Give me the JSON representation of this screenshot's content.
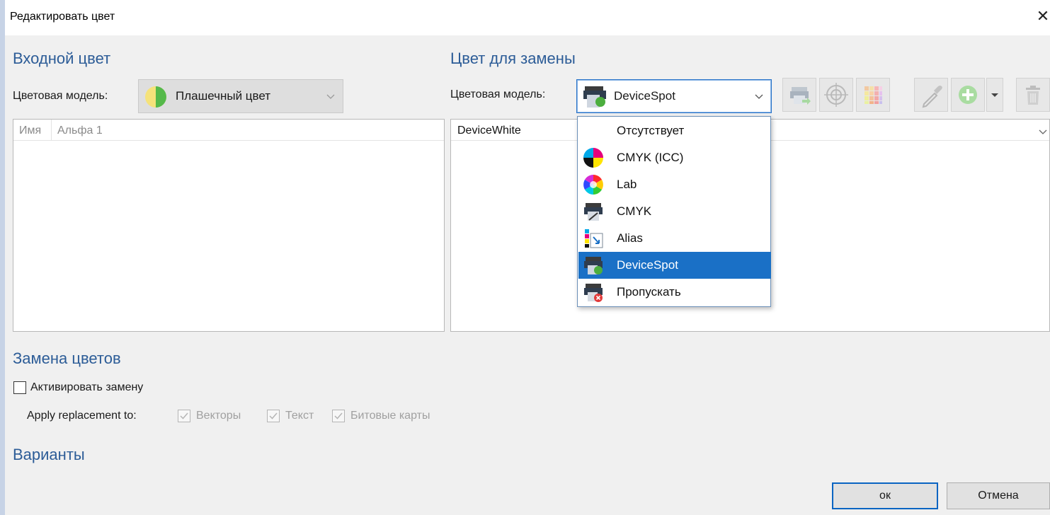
{
  "window": {
    "title": "Редактировать цвет",
    "close_glyph": "✕"
  },
  "input_color": {
    "heading": "Входной цвет",
    "model_label": "Цветовая модель:",
    "model_value": "Плашечный цвет",
    "model_icon": "spot-color-icon",
    "table": {
      "col_name": "Имя",
      "col_value": "Альфа 1"
    }
  },
  "replace_color": {
    "heading": "Цвет для замены",
    "model_label": "Цветовая модель:",
    "model_value": "DeviceSpot",
    "model_icon": "device-spot-icon",
    "value_selected": "DeviceWhite",
    "toolbar_icons": [
      "printer-arrow-icon",
      "target-icon",
      "color-grid-icon",
      "eyedropper-icon",
      "add-icon",
      "dropdown-arrow-icon",
      "trash-icon"
    ]
  },
  "dropdown": {
    "items": [
      {
        "label": "Отсутствует",
        "icon": "none"
      },
      {
        "label": "CMYK (ICC)",
        "icon": "cmyk-icc-icon"
      },
      {
        "label": "Lab",
        "icon": "lab-icon"
      },
      {
        "label": "CMYK",
        "icon": "cmyk-printer-icon"
      },
      {
        "label": "Alias",
        "icon": "alias-icon"
      },
      {
        "label": "DeviceSpot",
        "icon": "device-spot-icon",
        "selected": true
      },
      {
        "label": "Пропускать",
        "icon": "skip-icon"
      }
    ]
  },
  "replacement": {
    "heading": "Замена цветов",
    "activate_label": "Активировать замену",
    "apply_label": "Apply replacement to:",
    "options": [
      "Векторы",
      "Текст",
      "Битовые карты"
    ]
  },
  "variants": {
    "heading": "Варианты"
  },
  "buttons": {
    "ok": "ок",
    "cancel": "Отмена"
  },
  "colors": {
    "accent": "#2c5c97",
    "selection": "#1a70c6",
    "ok_border": "#0a64c2"
  }
}
